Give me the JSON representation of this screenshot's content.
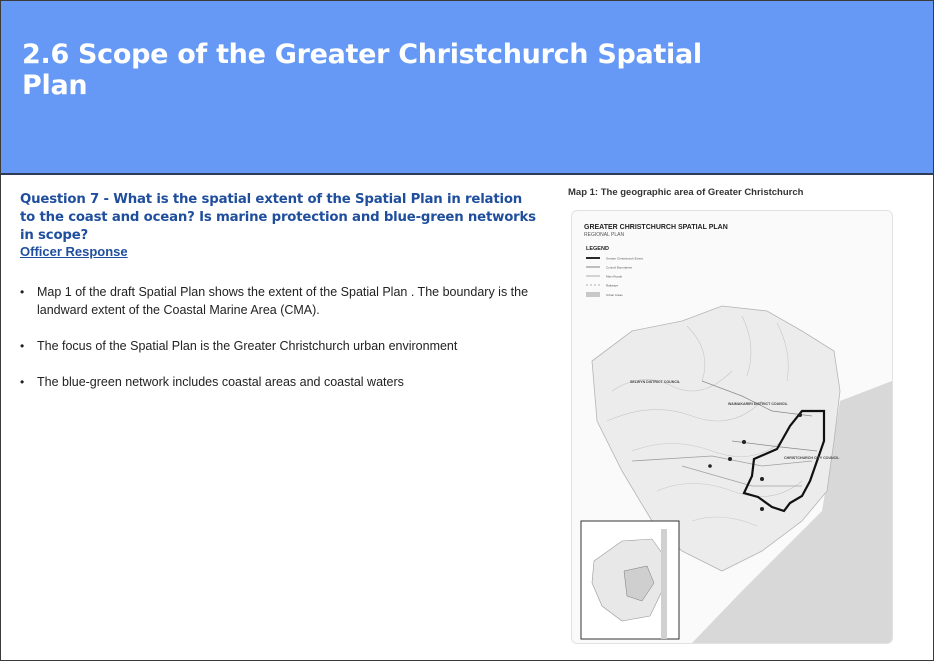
{
  "header": {
    "title": "2.6 Scope of the Greater Christchurch Spatial Plan",
    "background": "#6699f5"
  },
  "question": {
    "text": "Question 7 - What is the spatial extent of the Spatial Plan in relation to the coast and ocean? Is marine protection and blue-green networks in scope?",
    "color": "#1f4e9d"
  },
  "officer_response": {
    "heading": "Officer Response",
    "bullets": [
      "Map 1 of the draft Spatial Plan shows the extent of the Spatial Plan . The boundary is the landward extent of the Coastal Marine Area (CMA).",
      "The focus of the Spatial Plan is the Greater Christchurch urban environment",
      "The blue-green network includes coastal areas and coastal waters"
    ]
  },
  "map": {
    "caption": "Map 1: The geographic area of Greater Christchurch",
    "title": "GREATER CHRISTCHURCH SPATIAL PLAN",
    "subtitle": "REGIONAL PLAN",
    "legend_title": "LEGEND",
    "legend_items": [
      "Greater Christchurch Extent",
      "Council Boundaries",
      "Main Roads",
      "Railways",
      "Urban Areas"
    ],
    "labels": {
      "selwyn": "SELWYN DISTRICT COUNCIL",
      "waimakariri": "WAIMAKARIRI DISTRICT COUNCIL",
      "christchurch": "CHRISTCHURCH CITY COUNCIL"
    }
  }
}
